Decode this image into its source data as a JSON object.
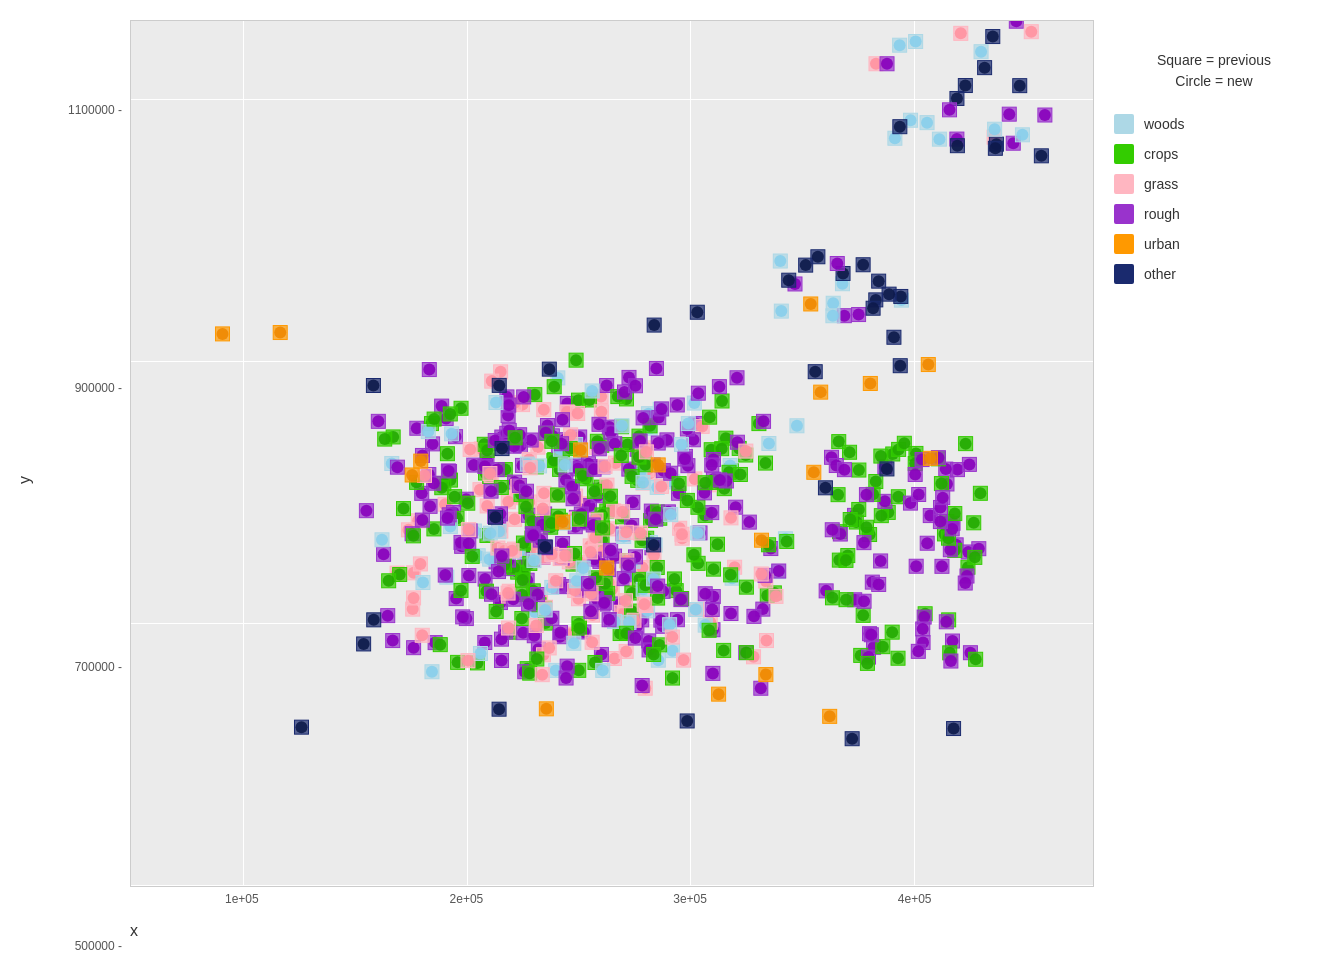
{
  "chart": {
    "title": "",
    "x_label": "x",
    "y_label": "y",
    "legend_title_line1": "Square = previous",
    "legend_title_line2": "Circle = new",
    "x_ticks": [
      "1e+05",
      "2e+05",
      "3e+05",
      "4e+05"
    ],
    "y_ticks": [
      "500000",
      "700000",
      "900000",
      "1100000"
    ],
    "y_tick_labels": [
      "500000 -",
      "700000 -",
      "900000 -",
      "1100000 -"
    ],
    "legend_items": [
      {
        "label": "woods",
        "color": "#add8e6",
        "border": "#add8e6"
      },
      {
        "label": "crops",
        "color": "#33cc00",
        "border": "#33cc00"
      },
      {
        "label": "grass",
        "color": "#ffb6c1",
        "border": "#ffb6c1"
      },
      {
        "label": "rough",
        "color": "#9933cc",
        "border": "#9933cc"
      },
      {
        "label": "urban",
        "color": "#ff9900",
        "border": "#ff9900"
      },
      {
        "label": "other",
        "color": "#1a2a6e",
        "border": "#1a2a6e"
      }
    ]
  }
}
